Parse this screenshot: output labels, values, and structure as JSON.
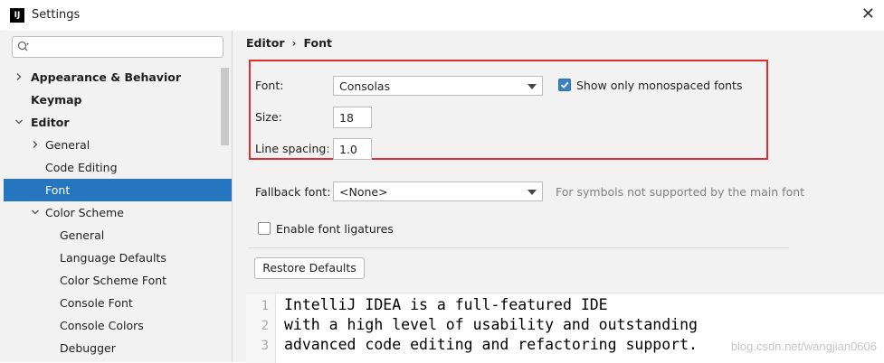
{
  "window": {
    "title": "Settings",
    "app_icon_text": "IJ",
    "close_symbol": "✕"
  },
  "search": {
    "placeholder": ""
  },
  "tree": {
    "items": [
      {
        "label": "Appearance & Behavior",
        "level": 0,
        "bold": true,
        "expander": "collapsed",
        "selected": false
      },
      {
        "label": "Keymap",
        "level": 0,
        "bold": true,
        "expander": "none",
        "selected": false
      },
      {
        "label": "Editor",
        "level": 0,
        "bold": true,
        "expander": "expanded",
        "selected": false
      },
      {
        "label": "General",
        "level": 1,
        "bold": false,
        "expander": "collapsed",
        "selected": false
      },
      {
        "label": "Code Editing",
        "level": 1,
        "bold": false,
        "expander": "none",
        "selected": false
      },
      {
        "label": "Font",
        "level": 1,
        "bold": false,
        "expander": "none",
        "selected": true
      },
      {
        "label": "Color Scheme",
        "level": 1,
        "bold": false,
        "expander": "expanded",
        "selected": false
      },
      {
        "label": "General",
        "level": 2,
        "bold": false,
        "expander": "none",
        "selected": false
      },
      {
        "label": "Language Defaults",
        "level": 2,
        "bold": false,
        "expander": "none",
        "selected": false
      },
      {
        "label": "Color Scheme Font",
        "level": 2,
        "bold": false,
        "expander": "none",
        "selected": false
      },
      {
        "label": "Console Font",
        "level": 2,
        "bold": false,
        "expander": "none",
        "selected": false
      },
      {
        "label": "Console Colors",
        "level": 2,
        "bold": false,
        "expander": "none",
        "selected": false
      },
      {
        "label": "Debugger",
        "level": 2,
        "bold": false,
        "expander": "none",
        "selected": false
      }
    ]
  },
  "breadcrumb": {
    "parent": "Editor",
    "separator": "›",
    "current": "Font"
  },
  "font_settings": {
    "font_label": "Font:",
    "font_value": "Consolas",
    "monospaced_label": "Show only monospaced fonts",
    "monospaced_checked": true,
    "size_label": "Size:",
    "size_value": "18",
    "line_spacing_label": "Line spacing:",
    "line_spacing_value": "1.0",
    "fallback_label": "Fallback font:",
    "fallback_value": "<None>",
    "fallback_hint": "For symbols not supported by the main font",
    "ligatures_label": "Enable font ligatures",
    "ligatures_checked": false,
    "restore_button": "Restore Defaults"
  },
  "preview": {
    "lines": [
      {
        "num": "1",
        "text": "IntelliJ IDEA is a full-featured IDE"
      },
      {
        "num": "2",
        "text": "with a high level of usability and outstanding"
      },
      {
        "num": "3",
        "text": "advanced code editing and refactoring support."
      }
    ]
  },
  "watermark": "blog.csdn.net/wangjian0606",
  "colors": {
    "selection": "#2675bf",
    "highlight_border": "#e12d2d",
    "checkbox_on": "#3b82c4"
  }
}
